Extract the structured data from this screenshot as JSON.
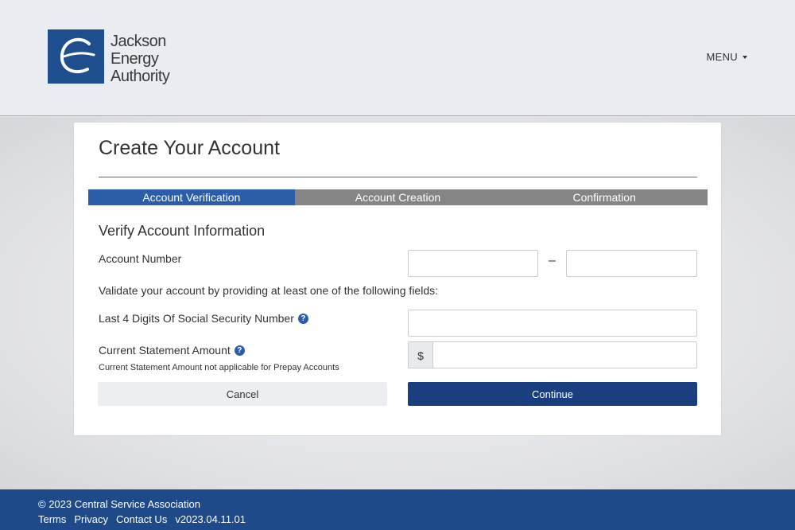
{
  "header": {
    "logo_text_line1": "Jackson",
    "logo_text_line2": "Energy",
    "logo_text_line3": "Authority",
    "menu_label": "MENU"
  },
  "card": {
    "title": "Create Your Account",
    "steps": [
      {
        "label": "Account Verification",
        "active": true
      },
      {
        "label": "Account Creation",
        "active": false
      },
      {
        "label": "Confirmation",
        "active": false
      }
    ],
    "section_title": "Verify Account Information",
    "account_number_label": "Account Number",
    "account_number_part1": "",
    "account_number_separator": "–",
    "account_number_part2": "",
    "validate_instruction": "Validate your account by providing at least one of the following fields:",
    "ssn_label": "Last 4 Digits Of Social Security Number",
    "ssn_value": "",
    "statement_label": "Current Statement Amount",
    "statement_note": "Current Statement Amount not applicable for Prepay Accounts",
    "currency_symbol": "$",
    "statement_value": "",
    "cancel_label": "Cancel",
    "continue_label": "Continue"
  },
  "footer": {
    "copyright": "© 2023 Central Service Association",
    "links": [
      "Terms",
      "Privacy",
      "Contact Us"
    ],
    "version": "v2023.04.11.01"
  },
  "colors": {
    "brand_blue": "#1f4e8f",
    "active_step": "#2a5ea8",
    "inactive_step": "#858585",
    "continue_button": "#1a3f7e",
    "footer_bg": "#1f4a8a"
  }
}
